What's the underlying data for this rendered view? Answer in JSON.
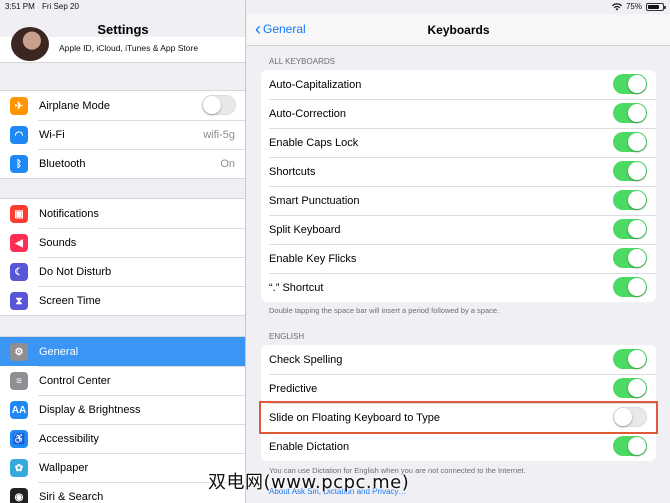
{
  "status_bar": {
    "time": "3:51 PM",
    "date": "Fri Sep 20",
    "battery": "75%",
    "wifi_icon": "wifi-icon",
    "battery_level": 0.75
  },
  "sidebar": {
    "title": "Settings",
    "profile_subtitle": "Apple ID, iCloud, iTunes & App Store",
    "groups": [
      [
        {
          "label": "Airplane Mode",
          "icon": "airplane-icon",
          "color": "#ff9500",
          "toggle": "off"
        },
        {
          "label": "Wi-Fi",
          "icon": "wifi-icon",
          "color": "#1e88f5",
          "value": "wifi-5g"
        },
        {
          "label": "Bluetooth",
          "icon": "bluetooth-icon",
          "color": "#1e88f5",
          "value": "On"
        }
      ],
      [
        {
          "label": "Notifications",
          "icon": "notifications-icon",
          "color": "#ff3b30"
        },
        {
          "label": "Sounds",
          "icon": "sounds-icon",
          "color": "#ff2d55"
        },
        {
          "label": "Do Not Disturb",
          "icon": "moon-icon",
          "color": "#5856d6"
        },
        {
          "label": "Screen Time",
          "icon": "hourglass-icon",
          "color": "#5856d6"
        }
      ],
      [
        {
          "label": "General",
          "icon": "gear-icon",
          "color": "#8e8e93",
          "selected": true
        },
        {
          "label": "Control Center",
          "icon": "control-center-icon",
          "color": "#8e8e93"
        },
        {
          "label": "Display & Brightness",
          "icon": "display-icon",
          "color": "#1e88f5"
        },
        {
          "label": "Accessibility",
          "icon": "accessibility-icon",
          "color": "#1e88f5"
        },
        {
          "label": "Wallpaper",
          "icon": "wallpaper-icon",
          "color": "#34aadc"
        },
        {
          "label": "Siri & Search",
          "icon": "siri-icon",
          "color": "#222222"
        }
      ]
    ]
  },
  "detail": {
    "back_label": "General",
    "title": "Keyboards",
    "all_keyboards_header": "ALL KEYBOARDS",
    "all_keyboards": [
      {
        "label": "Auto-Capitalization",
        "on": true
      },
      {
        "label": "Auto-Correction",
        "on": true
      },
      {
        "label": "Enable Caps Lock",
        "on": true
      },
      {
        "label": "Shortcuts",
        "on": true
      },
      {
        "label": "Smart Punctuation",
        "on": true
      },
      {
        "label": "Split Keyboard",
        "on": true
      },
      {
        "label": "Enable Key Flicks",
        "on": true
      },
      {
        "label": "“.” Shortcut",
        "on": true
      }
    ],
    "all_keyboards_footer": "Double tapping the space bar will insert a period followed by a space.",
    "english_header": "ENGLISH",
    "english": [
      {
        "label": "Check Spelling",
        "on": true
      },
      {
        "label": "Predictive",
        "on": true
      },
      {
        "label": "Slide on Floating Keyboard to Type",
        "on": false,
        "highlighted": true
      },
      {
        "label": "Enable Dictation",
        "on": true
      }
    ],
    "english_footer": "You can use Dictation for English when you are not connected to the Internet.",
    "english_footer_link": "About Ask Siri, Dictation and Privacy…"
  },
  "colors": {
    "accent": "#1577f8",
    "toggle_on": "#4cd964",
    "selected_row": "#3a95f4",
    "highlight_box": "#e05a3a"
  },
  "watermark": "双电网(www.pcpc.me)"
}
